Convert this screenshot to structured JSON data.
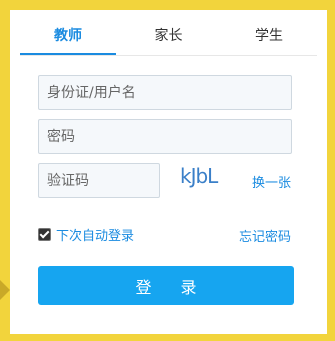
{
  "tabs": [
    {
      "label": "教师",
      "active": true
    },
    {
      "label": "家长",
      "active": false
    },
    {
      "label": "学生",
      "active": false
    }
  ],
  "form": {
    "username_placeholder": "身份证/用户名",
    "password_placeholder": "密码",
    "captcha_placeholder": "验证码",
    "captcha_text": "kJbL",
    "refresh_captcha": "换一张",
    "remember_me": "下次自动登录",
    "remember_checked": true,
    "forgot_password": "忘记密码",
    "login_button": "登 录"
  },
  "colors": {
    "accent": "#1a8be0",
    "button": "#16a5f0",
    "background": "#f2d43c"
  }
}
